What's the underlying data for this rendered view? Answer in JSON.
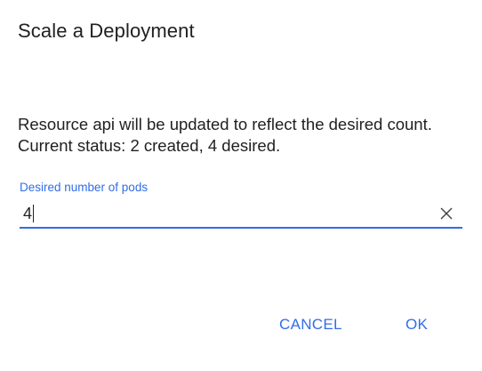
{
  "dialog": {
    "title": "Scale a Deployment",
    "message_line1": "Resource api will be updated to reflect the desired count.",
    "message_line2": "Current status: 2 created, 4 desired."
  },
  "field": {
    "label": "Desired number of pods",
    "value": "4"
  },
  "actions": {
    "cancel_label": "CANCEL",
    "ok_label": "OK"
  },
  "icons": {
    "clear": "close-icon"
  },
  "colors": {
    "accent": "#326de6",
    "text": "#212121",
    "background": "#ffffff"
  }
}
